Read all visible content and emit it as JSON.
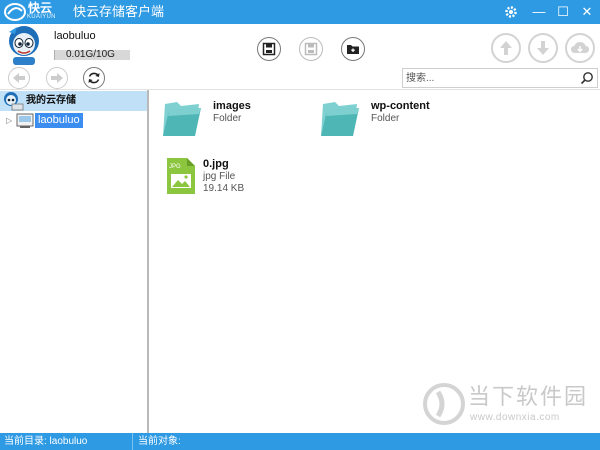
{
  "app": {
    "logo_text": "快云",
    "logo_sub": "KUAIYUN",
    "title": "快云存储客户端",
    "settings_icon": "gear-icon",
    "minimize_label": "—",
    "maximize_label": "☐",
    "close_label": "✕"
  },
  "header": {
    "username": "laobuluo",
    "quota_text": "0.01G/10G",
    "quota_used_fraction": 0.001,
    "toolbar_icons": [
      "save-icon",
      "save-disabled-icon",
      "new-folder-icon"
    ],
    "transfer_icons": [
      "upload-arrow-icon",
      "download-arrow-icon",
      "cloud-download-icon"
    ]
  },
  "nav": {
    "back_icon": "arrow-left-icon",
    "forward_icon": "arrow-right-icon",
    "refresh_icon": "refresh-icon",
    "search_placeholder": "搜索..."
  },
  "sidebar": {
    "root_label": "我的云存储",
    "child_label": "laobuluo"
  },
  "files": [
    {
      "name": "images",
      "type": "Folder",
      "size": ""
    },
    {
      "name": "wp-content",
      "type": "Folder",
      "size": ""
    },
    {
      "name": "0.jpg",
      "type": "jpg File",
      "size": "19.14 KB",
      "icon_badge": "JPG"
    }
  ],
  "watermark": {
    "text": "当下软件园",
    "url": "www.downxia.com"
  },
  "status": {
    "current_dir": "当前目录: laobuluo",
    "current_object": "当前对象:"
  },
  "colors": {
    "accent": "#2e9ae3",
    "selection": "#3b8ef0",
    "folder": "#5fbfbf",
    "image_file": "#8cc63f"
  }
}
